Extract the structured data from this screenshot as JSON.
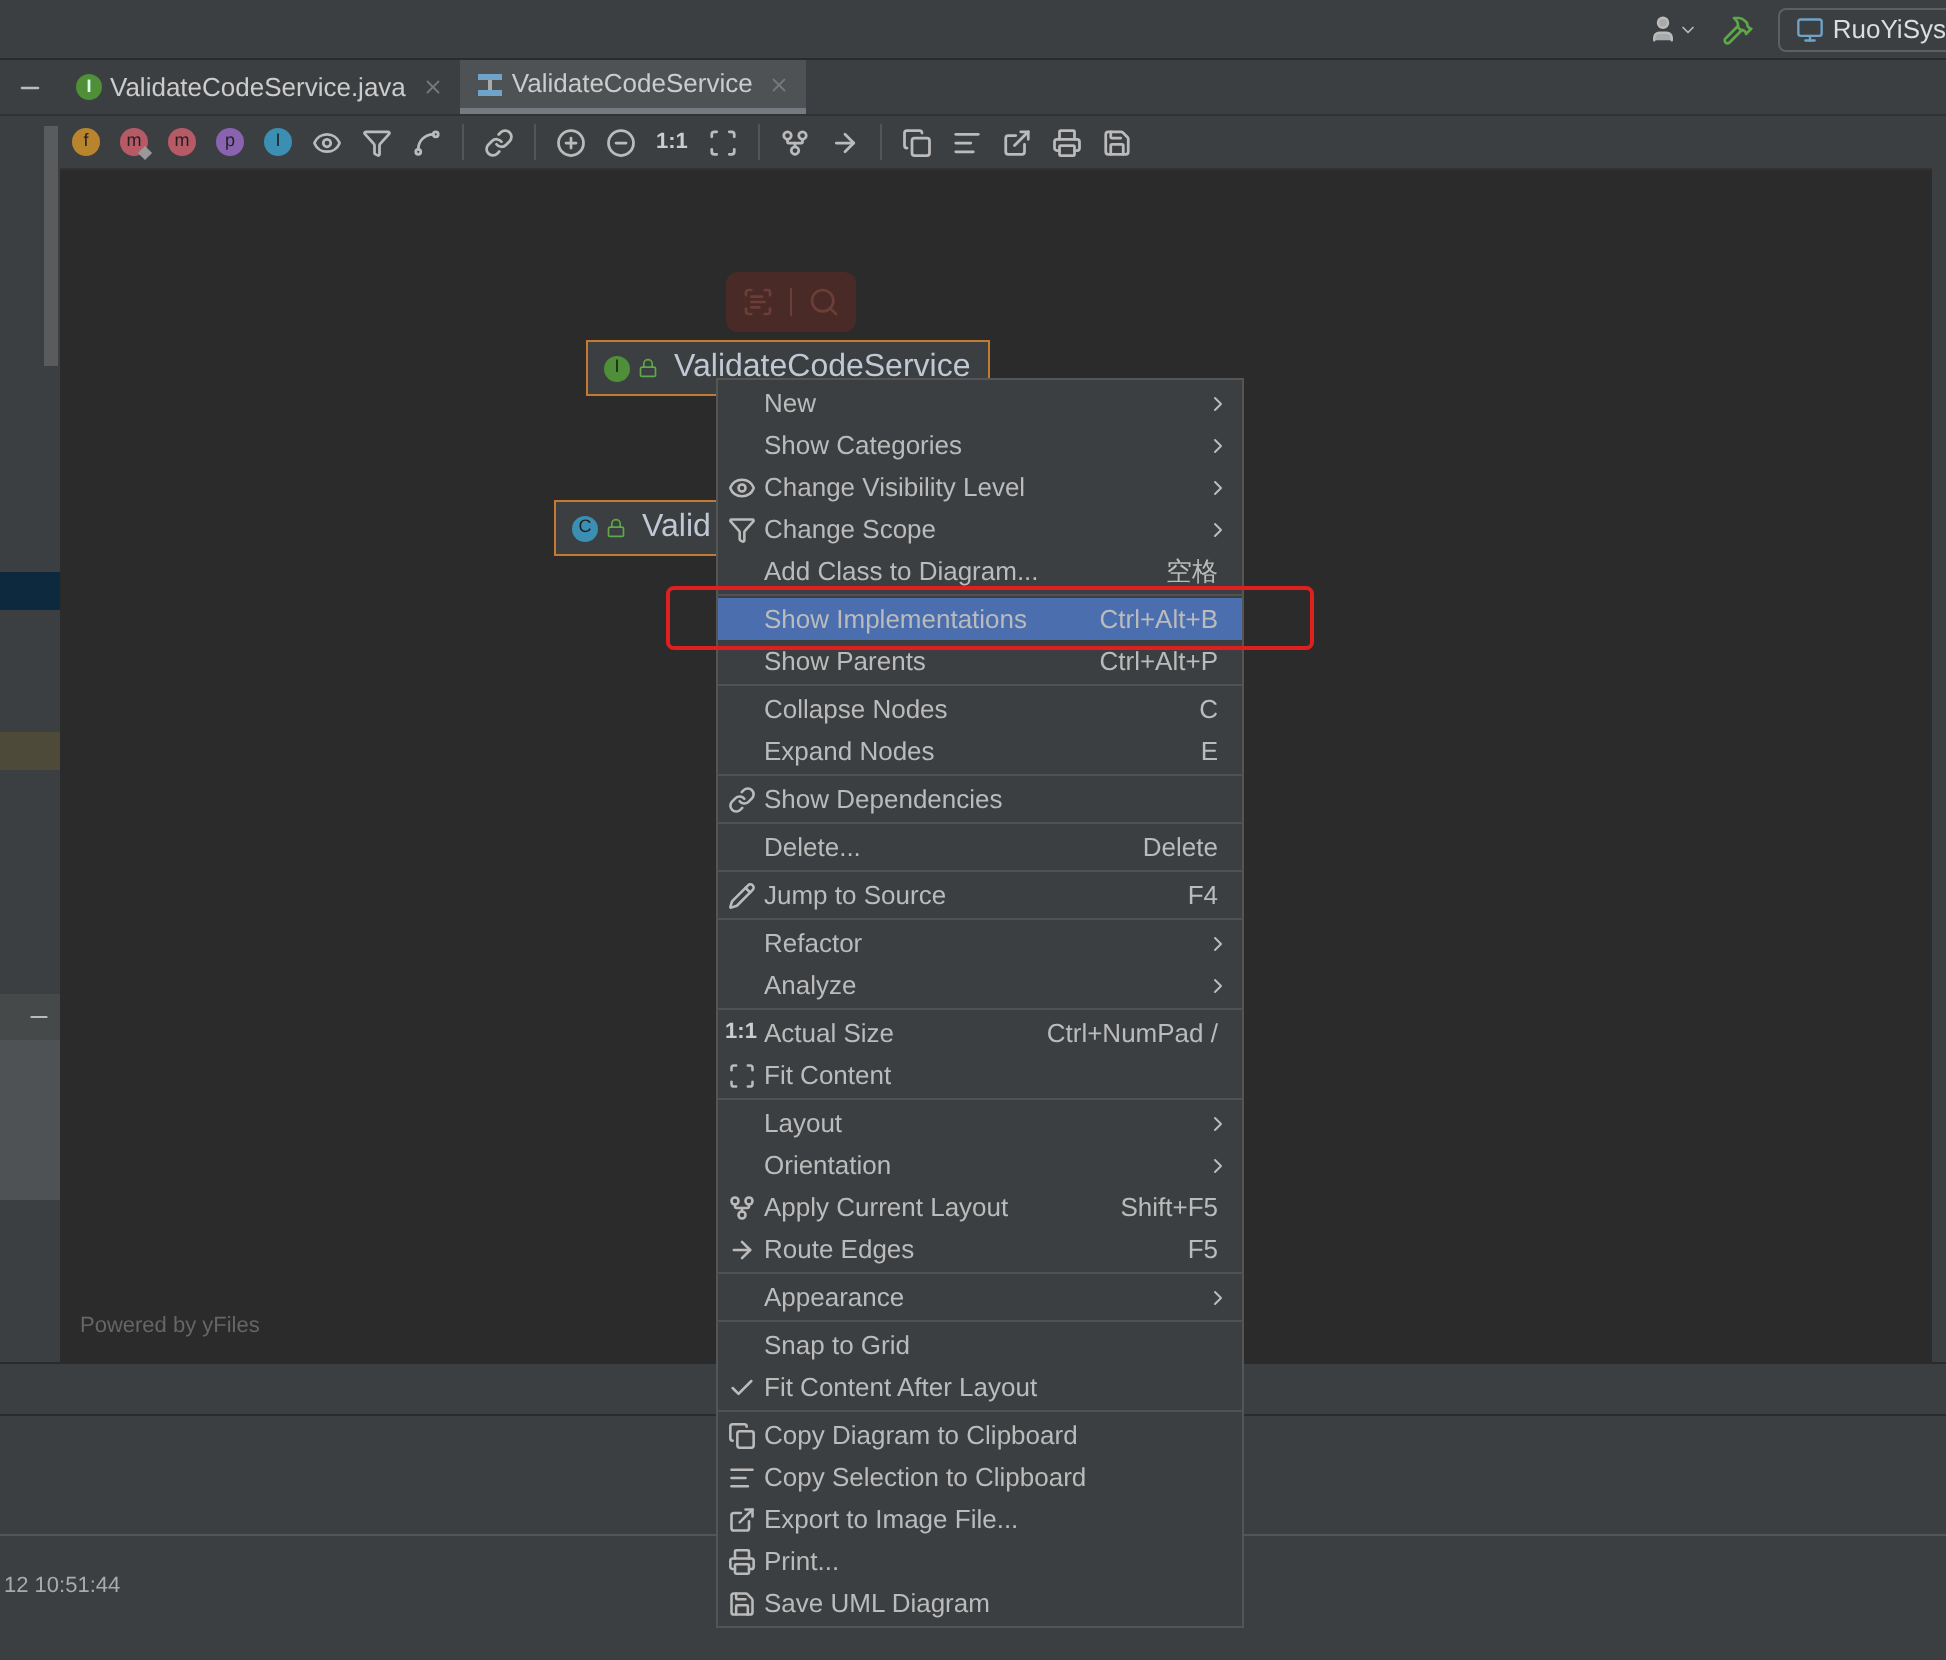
{
  "top_bar": {
    "run_config": "RuoYiSys"
  },
  "tabs": [
    {
      "label": "ValidateCodeService.java",
      "badge": "I",
      "color": "#4e8f37",
      "kind": "file",
      "selected": false
    },
    {
      "label": "ValidateCodeService",
      "kind": "diagram",
      "selected": true
    }
  ],
  "toolbar": [
    {
      "kind": "badge",
      "letter": "f",
      "color": "#b8852e",
      "starred": false
    },
    {
      "kind": "badge",
      "letter": "m",
      "color": "#b65a66",
      "starred": true
    },
    {
      "kind": "badge",
      "letter": "m",
      "color": "#b65a66",
      "starred": false
    },
    {
      "kind": "badge",
      "letter": "p",
      "color": "#8a63b0",
      "starred": false
    },
    {
      "kind": "badge",
      "letter": "I",
      "color": "#3b8fb3",
      "starred": false
    },
    {
      "kind": "eye"
    },
    {
      "kind": "filter"
    },
    {
      "kind": "edge"
    },
    {
      "kind": "sep"
    },
    {
      "kind": "link"
    },
    {
      "kind": "sep"
    },
    {
      "kind": "zoomin"
    },
    {
      "kind": "zoomout"
    },
    {
      "kind": "text",
      "label": "1:1"
    },
    {
      "kind": "fit"
    },
    {
      "kind": "sep"
    },
    {
      "kind": "layout"
    },
    {
      "kind": "route"
    },
    {
      "kind": "sep"
    },
    {
      "kind": "copy"
    },
    {
      "kind": "selection"
    },
    {
      "kind": "export"
    },
    {
      "kind": "print"
    },
    {
      "kind": "save"
    }
  ],
  "canvas": {
    "nodes": [
      {
        "badge": "I",
        "color": "#4e8f37",
        "label": "ValidateCodeService"
      },
      {
        "badge": "C",
        "color": "#3b8fb3",
        "label": "Valid"
      }
    ],
    "footer": "Powered by yFiles"
  },
  "menu": {
    "groups": [
      [
        {
          "kind": "plain",
          "label": "New",
          "submenu": true,
          "selected": false,
          "outlined": false
        },
        {
          "kind": "plain",
          "label": "Show Categories",
          "submenu": true,
          "selected": false,
          "outlined": false
        },
        {
          "kind": "eye",
          "label": "Change Visibility Level",
          "submenu": true,
          "selected": false,
          "outlined": false
        },
        {
          "kind": "filter",
          "label": "Change Scope",
          "submenu": true,
          "selected": false,
          "outlined": false
        },
        {
          "kind": "plain",
          "label": "Add Class to Diagram...",
          "shortcut": "空格",
          "submenu": false,
          "selected": false,
          "outlined": false
        }
      ],
      [
        {
          "kind": "plain",
          "label": "Show Implementations",
          "shortcut": "Ctrl+Alt+B",
          "submenu": false,
          "selected": true,
          "outlined": true
        },
        {
          "kind": "plain",
          "label": "Show Parents",
          "shortcut": "Ctrl+Alt+P",
          "submenu": false,
          "selected": false,
          "outlined": false
        }
      ],
      [
        {
          "kind": "plain",
          "label": "Collapse Nodes",
          "shortcut": "C",
          "submenu": false,
          "selected": false,
          "outlined": false
        },
        {
          "kind": "plain",
          "label": "Expand Nodes",
          "shortcut": "E",
          "submenu": false,
          "selected": false,
          "outlined": false
        }
      ],
      [
        {
          "kind": "link",
          "label": "Show Dependencies",
          "submenu": false,
          "selected": false,
          "outlined": false
        }
      ],
      [
        {
          "kind": "plain",
          "label": "Delete...",
          "shortcut": "Delete",
          "submenu": false,
          "selected": false,
          "outlined": false
        }
      ],
      [
        {
          "kind": "pencil",
          "label": "Jump to Source",
          "shortcut": "F4",
          "submenu": false,
          "selected": false,
          "outlined": false
        }
      ],
      [
        {
          "kind": "plain",
          "label": "Refactor",
          "submenu": true,
          "selected": false,
          "outlined": false
        },
        {
          "kind": "plain",
          "label": "Analyze",
          "submenu": true,
          "selected": false,
          "outlined": false
        }
      ],
      [
        {
          "kind": "text",
          "glyph": "1:1",
          "label": "Actual Size",
          "shortcut": "Ctrl+NumPad /",
          "submenu": false,
          "selected": false,
          "outlined": false
        },
        {
          "kind": "fit",
          "label": "Fit Content",
          "submenu": false,
          "selected": false,
          "outlined": false
        }
      ],
      [
        {
          "kind": "plain",
          "label": "Layout",
          "submenu": true,
          "selected": false,
          "outlined": false
        },
        {
          "kind": "plain",
          "label": "Orientation",
          "submenu": true,
          "selected": false,
          "outlined": false
        },
        {
          "kind": "layout",
          "label": "Apply Current Layout",
          "shortcut": "Shift+F5",
          "submenu": false,
          "selected": false,
          "outlined": false
        },
        {
          "kind": "route",
          "label": "Route Edges",
          "shortcut": "F5",
          "submenu": false,
          "selected": false,
          "outlined": false
        }
      ],
      [
        {
          "kind": "plain",
          "label": "Appearance",
          "submenu": true,
          "selected": false,
          "outlined": false
        }
      ],
      [
        {
          "kind": "plain",
          "label": "Snap to Grid",
          "submenu": false,
          "selected": false,
          "outlined": false
        },
        {
          "kind": "check",
          "label": "Fit Content After Layout",
          "submenu": false,
          "selected": false,
          "outlined": false
        }
      ],
      [
        {
          "kind": "copy",
          "label": "Copy Diagram to Clipboard",
          "submenu": false,
          "selected": false,
          "outlined": false
        },
        {
          "kind": "selection",
          "label": "Copy Selection to Clipboard",
          "submenu": false,
          "selected": false,
          "outlined": false
        },
        {
          "kind": "export",
          "label": "Export to Image File...",
          "submenu": false,
          "selected": false,
          "outlined": false
        },
        {
          "kind": "print",
          "label": "Print...",
          "submenu": false,
          "selected": false,
          "outlined": false
        },
        {
          "kind": "save",
          "label": "Save UML Diagram",
          "submenu": false,
          "selected": false,
          "outlined": false
        }
      ]
    ]
  },
  "status": {
    "timestamp": "12 10:51:44"
  }
}
